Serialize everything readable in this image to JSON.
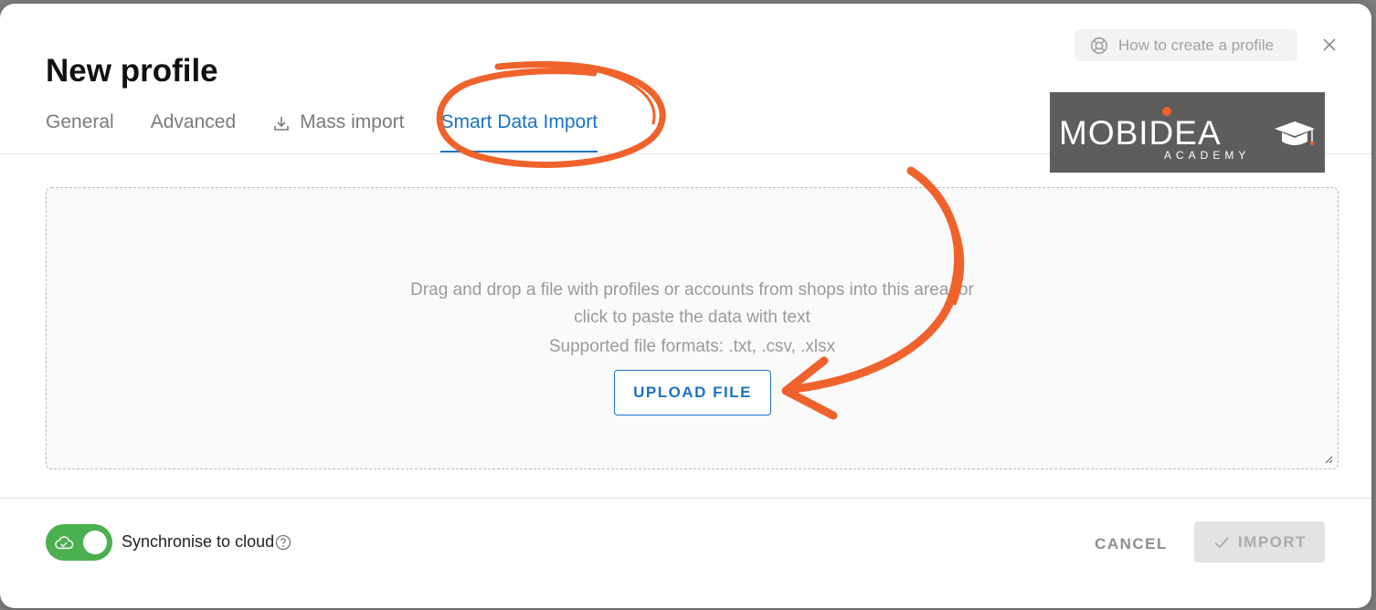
{
  "modal": {
    "title": "New profile",
    "help_button_label": "How to create a profile"
  },
  "tabs": [
    {
      "label": "General",
      "active": false
    },
    {
      "label": "Advanced",
      "active": false
    },
    {
      "label": "Mass import",
      "active": false,
      "icon": "download-icon"
    },
    {
      "label": "Smart Data Import",
      "active": true
    }
  ],
  "logo": {
    "main": "MOBIDEA",
    "sub": "ACADEMY"
  },
  "dropzone": {
    "line1": "Drag and drop a file with profiles or accounts from shops into this area, or",
    "line2": "click to paste the data with text",
    "formats": "Supported file formats: .txt, .csv, .xlsx",
    "upload_label": "UPLOAD FILE"
  },
  "footer": {
    "sync_label": "Synchronise to cloud",
    "sync_enabled": true,
    "cancel_label": "CANCEL",
    "import_label": "IMPORT"
  },
  "colors": {
    "accent": "#1a73c8",
    "toggle_on": "#4caf50",
    "annotation": "#f0622b"
  }
}
